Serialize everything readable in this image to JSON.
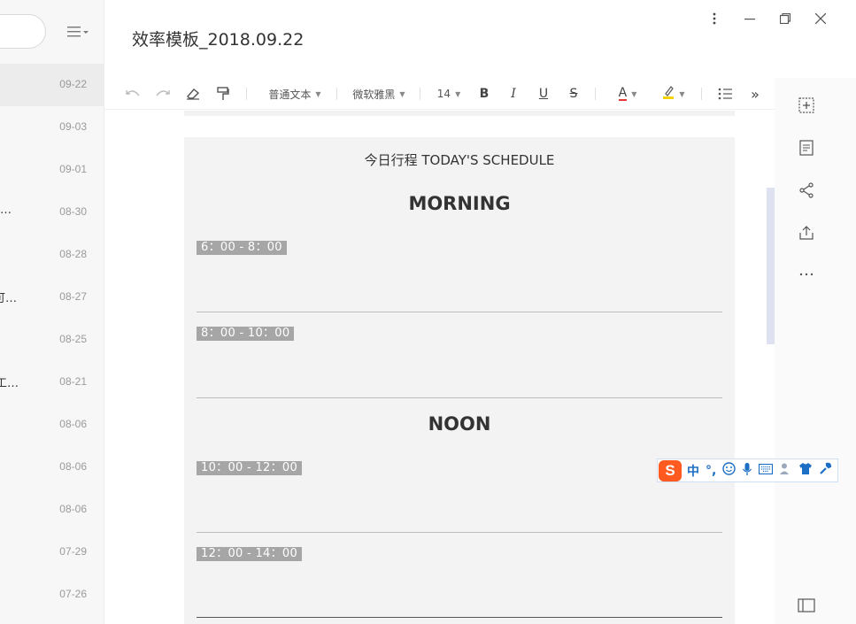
{
  "window": {
    "title": "效率模板_2018.09.22",
    "controls": [
      "more-icon",
      "minimize-icon",
      "restore-icon",
      "close-icon"
    ]
  },
  "note_list": {
    "items": [
      {
        "date": "09-22",
        "snippet": "",
        "selected": true
      },
      {
        "date": "09-03",
        "snippet": ""
      },
      {
        "date": "09-01",
        "snippet": ""
      },
      {
        "date": "08-30",
        "snippet": "…"
      },
      {
        "date": "08-28",
        "snippet": ""
      },
      {
        "date": "08-27",
        "snippet": "可…"
      },
      {
        "date": "08-25",
        "snippet": ""
      },
      {
        "date": "08-21",
        "snippet": "工…"
      },
      {
        "date": "08-06",
        "snippet": ""
      },
      {
        "date": "08-06",
        "snippet": ""
      },
      {
        "date": "08-06",
        "snippet": ""
      },
      {
        "date": "07-29",
        "snippet": ""
      },
      {
        "date": "07-26",
        "snippet": ""
      }
    ]
  },
  "toolbar": {
    "paragraph_style": "普通文本",
    "font_family": "微软雅黑",
    "font_size": "14",
    "bold_label": "B",
    "italic_label": "I",
    "underline_label": "U",
    "strike_label": "S",
    "font_color_label": "A",
    "more_label": "»"
  },
  "document": {
    "header": "今日行程 TODAY'S SCHEDULE",
    "sections": [
      {
        "title": "MORNING"
      },
      {
        "title": "NOON"
      }
    ],
    "slots": [
      {
        "time": "6：00 - 8：00"
      },
      {
        "time": "8：00 - 10：00"
      },
      {
        "time": "10：00 - 12：00"
      },
      {
        "time": "12：00 - 14：00"
      }
    ]
  },
  "ime": {
    "logo": "S",
    "mode": "中",
    "punct": "°,"
  },
  "colors": {
    "accent_scroll": "#dde1f0",
    "tag_bg": "#a6a6a6",
    "doc_bg": "#f3f3f3",
    "ime_logo": "#ff5a1f",
    "ime_icon": "#1d6fc6",
    "font_color_underline": "#e53935",
    "highlight_yellow": "#f5d300"
  }
}
